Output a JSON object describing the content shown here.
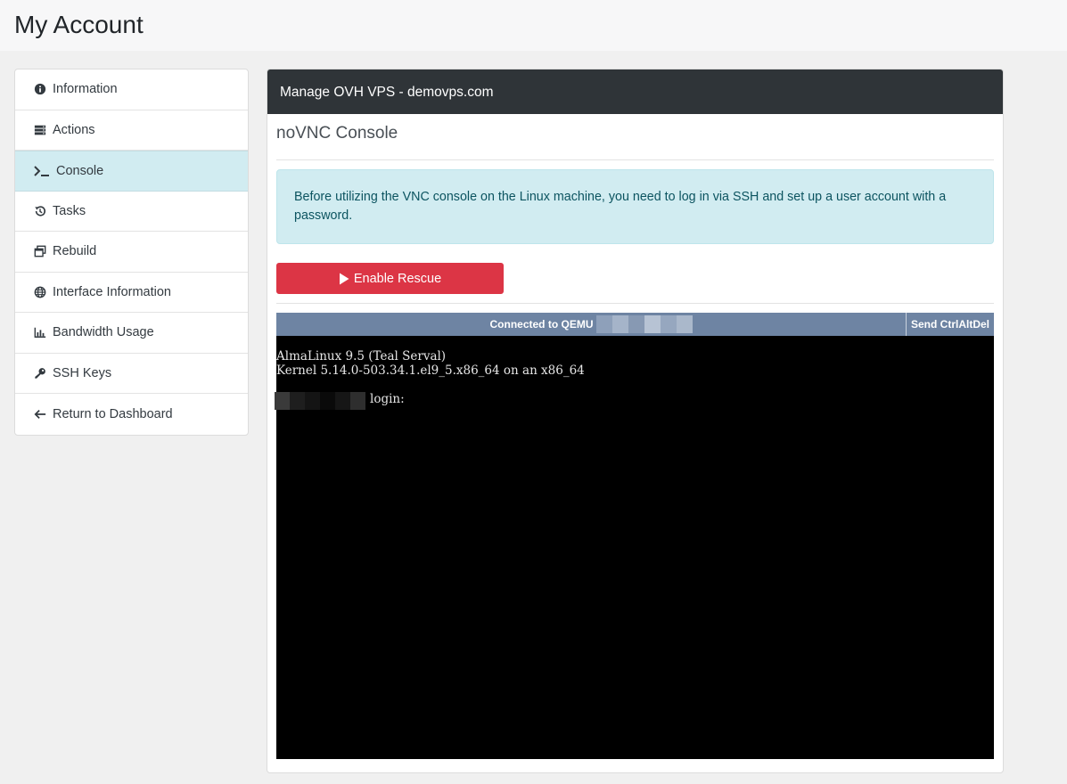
{
  "page": {
    "title": "My Account"
  },
  "sidebar": {
    "items": [
      {
        "label": "Information",
        "icon": "info-circle-icon"
      },
      {
        "label": "Actions",
        "icon": "server-icon"
      },
      {
        "label": "Console",
        "icon": "terminal-icon",
        "active": true
      },
      {
        "label": "Tasks",
        "icon": "history-icon"
      },
      {
        "label": "Rebuild",
        "icon": "window-restore-icon"
      },
      {
        "label": "Interface Information",
        "icon": "globe-icon"
      },
      {
        "label": "Bandwidth Usage",
        "icon": "chart-bar-icon"
      },
      {
        "label": "SSH Keys",
        "icon": "key-icon"
      },
      {
        "label": "Return to Dashboard",
        "icon": "arrow-left-icon"
      }
    ]
  },
  "main": {
    "header": "Manage OVH VPS - demovps.com",
    "section_title": "noVNC Console",
    "alert": "Before utilizing the VNC console on the Linux machine, you need to log in via SSH and set up a user account with a password.",
    "rescue_button": "Enable Rescue"
  },
  "vnc": {
    "status": "Connected to QEMU",
    "send_button": "Send CtrlAltDel",
    "terminal": {
      "line1": "AlmaLinux 9.5 (Teal Serval)",
      "line2": "Kernel 5.14.0-503.34.1.el9_5.x86_64 on an x86_64",
      "login_prompt": "login:"
    }
  },
  "colors": {
    "header_bar": "#2f3438",
    "active_item": "#d1ecf1",
    "alert_bg": "#d1ecf1",
    "alert_text": "#0c5460",
    "danger": "#dc3545",
    "vnc_bar": "#6e84a3"
  }
}
